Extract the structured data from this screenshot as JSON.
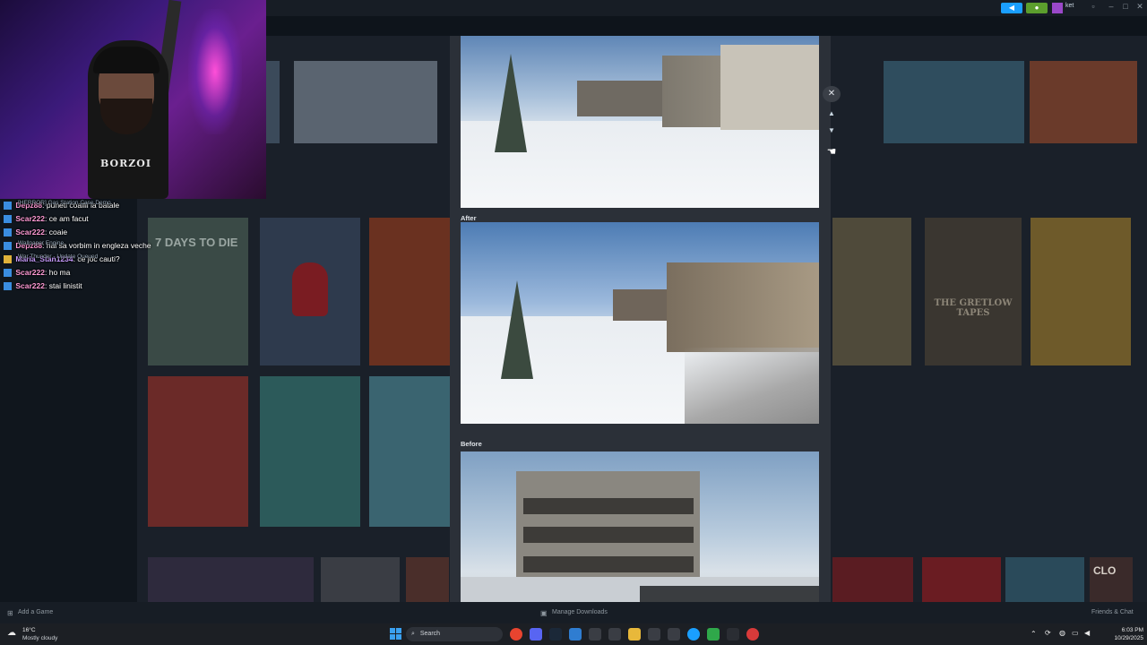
{
  "window": {
    "topbar_user": "ket",
    "accent_blue": "#1a9fff",
    "accent_green": "#5c9e2d"
  },
  "chat": [
    {
      "user": "Depz88",
      "text": "puneti coailii la batale",
      "note": "[HERROR] Gas Station Case Demo"
    },
    {
      "user": "Scar222",
      "text": "ce am facut"
    },
    {
      "user": "Scar222",
      "text": "coaie"
    },
    {
      "user": "Depz88",
      "text": "hai sa vorbim in engleza veche",
      "note": "Wallpaper Engine"
    },
    {
      "user": "Maria_Stan1234",
      "text": "ce joc cauti?",
      "note": "War Thunder - Update Queued"
    },
    {
      "user": "Scar222",
      "text": "ho ma"
    },
    {
      "user": "Scar222",
      "text": "stai linistit"
    }
  ],
  "webcam": {
    "shirt_text": "BORZOI"
  },
  "modal": {
    "caption_after": "After",
    "caption_before": "Before",
    "close_icon": "close-icon",
    "up_icon": "chevron-up-icon",
    "down_icon": "chevron-down-icon"
  },
  "library": {
    "tile_text_1": "7 DAYS TO DIE",
    "tile_text_2": "THE GRETLOW TAPES",
    "tile_text_3": "CLO"
  },
  "statusbar": {
    "add_game": "Add a Game",
    "manage_downloads": "Manage Downloads",
    "friends_chat": "Friends & Chat"
  },
  "taskbar": {
    "weather_temp": "16°C",
    "weather_desc": "Mostly cloudy",
    "search_placeholder": "Search",
    "time": "6:03 PM",
    "date": "10/29/2025"
  }
}
